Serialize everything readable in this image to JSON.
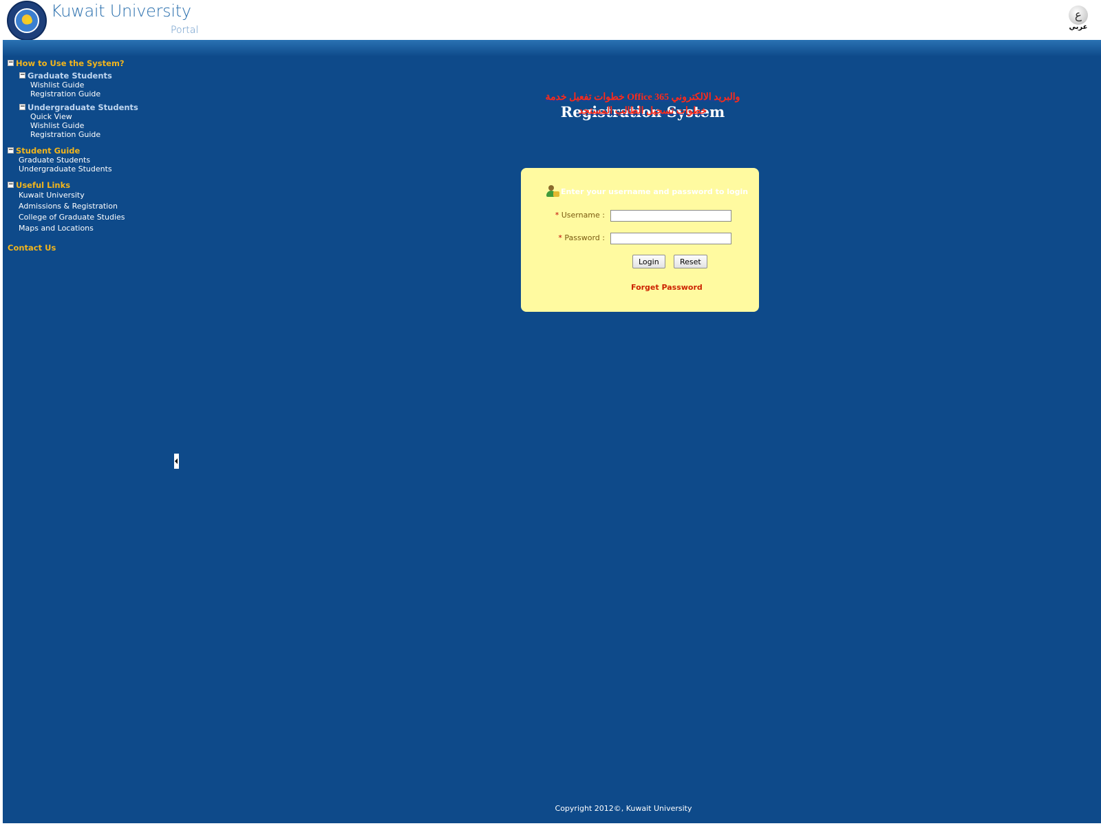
{
  "header": {
    "brand_title": "Kuwait University",
    "brand_subtitle": "Portal",
    "lang_glyph": "ع",
    "lang_label": "عربي"
  },
  "sidebar": {
    "how_to": {
      "title": "How to Use the System?",
      "graduate": {
        "title": "Graduate Students",
        "items": [
          "Wishlist Guide",
          "Registration Guide"
        ]
      },
      "undergraduate": {
        "title": "Undergraduate Students",
        "items": [
          "Quick View",
          "Wishlist Guide",
          "Registration Guide"
        ]
      }
    },
    "student_guide": {
      "title": "Student Guide",
      "items": [
        "Graduate Students",
        "Undergraduate Students"
      ]
    },
    "useful_links": {
      "title": "Useful Links",
      "items": [
        "Kuwait University",
        "Admissions & Registration",
        "College of Graduate Studies",
        "Maps and Locations"
      ]
    },
    "contact": "Contact Us"
  },
  "content": {
    "title": "Registration System",
    "notices": [
      "خطوات تفعيل خدمة Office 365 والبريد الالكتروني",
      "خطوات تسجيل الطالب المستجد"
    ]
  },
  "login": {
    "heading": "Enter your username and password to login",
    "username_label": "Username :",
    "password_label": "Password :",
    "required_marker": "*",
    "login_button": "Login",
    "reset_button": "Reset",
    "forget_password": "Forget Password",
    "username_value": "",
    "password_value": ""
  },
  "footer": {
    "copyright": "Copyright 2012©, Kuwait University"
  },
  "colors": {
    "main_bg": "#0e4a8a",
    "section_title": "#f2b51c",
    "login_box": "#fffaa0",
    "notice": "#ff2a1a"
  }
}
